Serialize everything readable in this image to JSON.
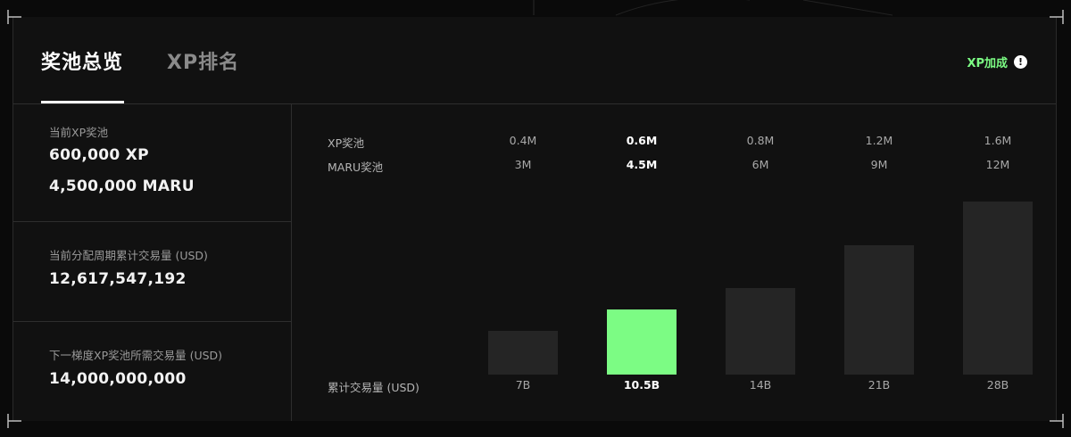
{
  "tabs": [
    {
      "label": "奖池总览",
      "active": true
    },
    {
      "label": "XP排名",
      "active": false
    }
  ],
  "xp_bonus": {
    "label": "XP加成",
    "icon": "info-icon",
    "icon_glyph": "!"
  },
  "stats": {
    "current_pool": {
      "label": "当前XP奖池",
      "xp": "600,000 XP",
      "maru": "4,500,000 MARU"
    },
    "cumulative_volume": {
      "label": "当前分配周期累计交易量 (USD)",
      "value": "12,617,547,192"
    },
    "next_tier": {
      "label": "下一梯度XP奖池所需交易量 (USD)",
      "value": "14,000,000,000"
    }
  },
  "tiers_table": {
    "row_labels": {
      "xp": "XP奖池",
      "maru": "MARU奖池",
      "volume": "累计交易量 (USD)"
    },
    "highlight_index": 1,
    "highlight_color": "#7CFC84",
    "bar_color": "#252525"
  },
  "chart_data": {
    "type": "bar",
    "categories": [
      "7B",
      "10.5B",
      "14B",
      "21B",
      "28B"
    ],
    "xp_pool": [
      "0.4M",
      "0.6M",
      "0.8M",
      "1.2M",
      "1.6M"
    ],
    "maru_pool": [
      "3M",
      "4.5M",
      "6M",
      "9M",
      "12M"
    ],
    "values": [
      0.4,
      0.6,
      0.8,
      1.2,
      1.6
    ],
    "ylim": [
      0,
      1.6
    ],
    "highlight_index": 1,
    "xlabel": "累计交易量 (USD)"
  }
}
